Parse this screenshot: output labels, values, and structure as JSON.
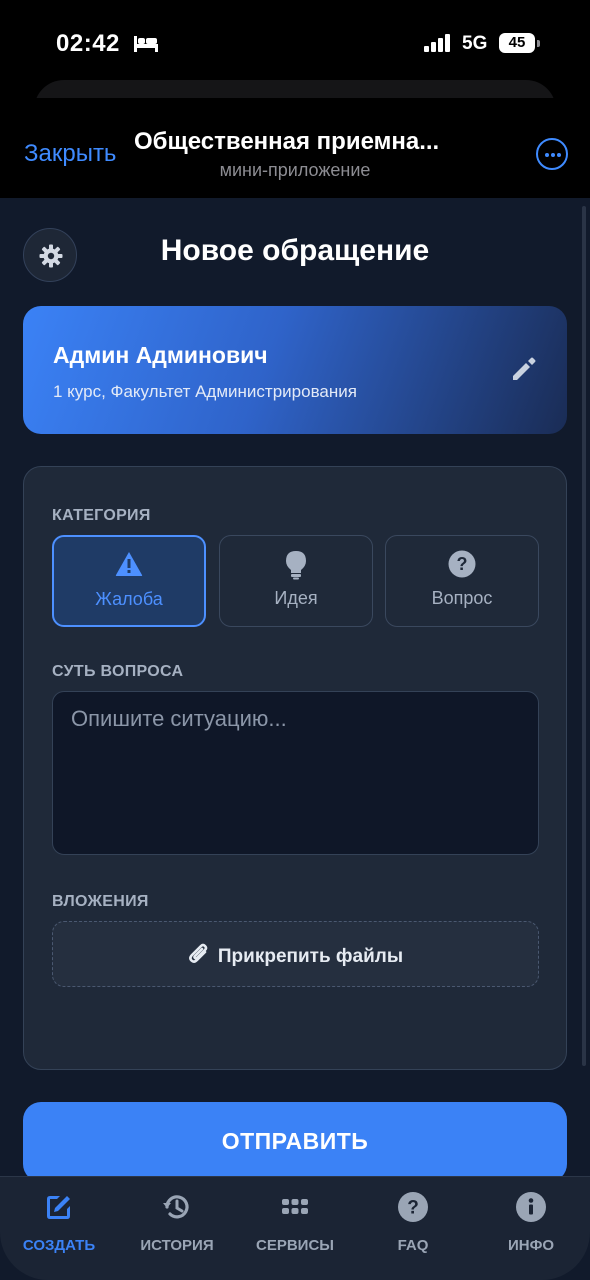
{
  "status_bar": {
    "time": "02:42",
    "network": "5G",
    "battery": "45"
  },
  "header": {
    "close_label": "Закрыть",
    "title": "Общественная приемна...",
    "subtitle": "мини-приложение"
  },
  "page": {
    "title": "Новое обращение"
  },
  "user": {
    "name": "Админ Админович",
    "info": "1 курс, Факультет Администрирования"
  },
  "form": {
    "category_label": "КАТЕГОРИЯ",
    "categories": [
      {
        "label": "Жалоба",
        "icon": "warning-icon",
        "selected": true
      },
      {
        "label": "Идея",
        "icon": "lightbulb-icon",
        "selected": false
      },
      {
        "label": "Вопрос",
        "icon": "question-icon",
        "selected": false
      }
    ],
    "question_label": "СУТЬ ВОПРОСА",
    "question_placeholder": "Опишите ситуацию...",
    "attachments_label": "ВЛОЖЕНИЯ",
    "attach_button": "Прикрепить файлы"
  },
  "submit_label": "ОТПРАВИТЬ",
  "tabs": [
    {
      "label": "СОЗДАТЬ",
      "icon": "edit-icon",
      "active": true
    },
    {
      "label": "ИСТОРИЯ",
      "icon": "history-icon",
      "active": false
    },
    {
      "label": "СЕРВИСЫ",
      "icon": "grid-icon",
      "active": false
    },
    {
      "label": "FAQ",
      "icon": "question-icon",
      "active": false
    },
    {
      "label": "ИНФО",
      "icon": "info-icon",
      "active": false
    }
  ],
  "colors": {
    "accent": "#3b82f6",
    "background": "#111a2b",
    "card": "#1f2939"
  }
}
